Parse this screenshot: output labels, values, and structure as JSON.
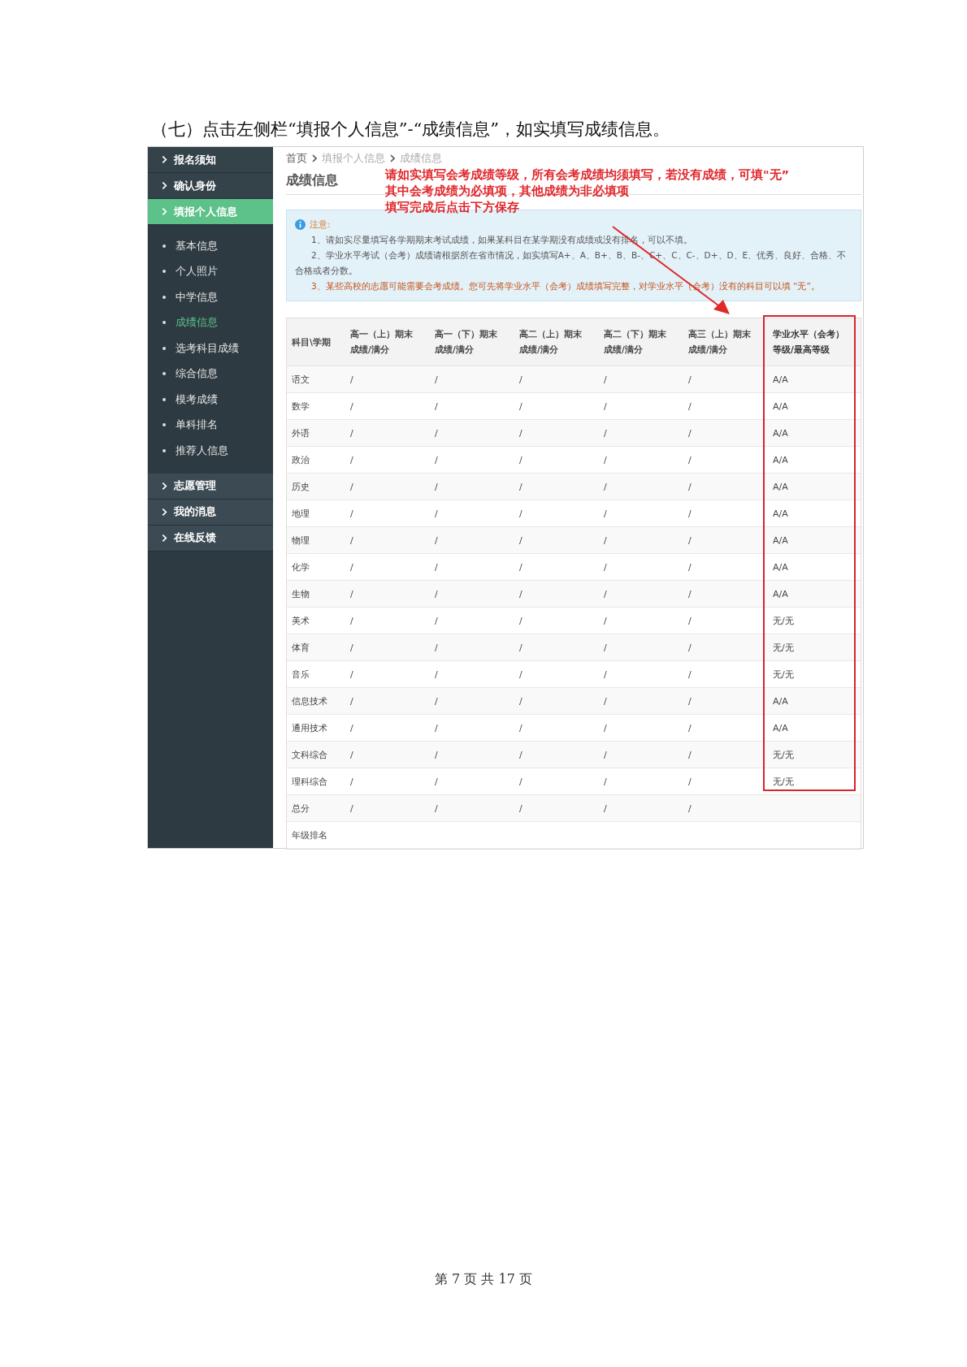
{
  "caption": "（七）点击左侧栏“填报个人信息”-“成绩信息”，如实填写成绩信息。",
  "sidebar": {
    "items": [
      {
        "label": "报名须知",
        "selected": false
      },
      {
        "label": "确认身份",
        "selected": false
      },
      {
        "label": "填报个人信息",
        "selected": true,
        "expanded": true,
        "children": [
          {
            "label": "基本信息",
            "selected": false
          },
          {
            "label": "个人照片",
            "selected": false
          },
          {
            "label": "中学信息",
            "selected": false
          },
          {
            "label": "成绩信息",
            "selected": true
          },
          {
            "label": "选考科目成绩",
            "selected": false
          },
          {
            "label": "综合信息",
            "selected": false
          },
          {
            "label": "模考成绩",
            "selected": false
          },
          {
            "label": "单科排名",
            "selected": false
          },
          {
            "label": "推荐人信息",
            "selected": false
          }
        ]
      },
      {
        "label": "志愿管理",
        "selected": false
      },
      {
        "label": "我的消息",
        "selected": false
      },
      {
        "label": "在线反馈",
        "selected": false
      }
    ]
  },
  "breadcrumb": [
    "首页",
    "填报个人信息",
    "成绩信息"
  ],
  "page_title": "成绩信息",
  "annotation": {
    "lines": [
      "请如实填写会考成绩等级，所有会考成绩均须填写，若没有成绩，可填\"无”",
      "其中会考成绩为必填项，其他成绩为非必填项",
      "填写完成后点击下方保存"
    ]
  },
  "notice": {
    "title": "注意:",
    "items": [
      {
        "kind": "normal",
        "text": "1、请如实尽量填写各学期期末考试成绩，如果某科目在某学期没有成绩或没有排名，可以不填。"
      },
      {
        "kind": "normal",
        "text": "2、学业水平考试（会考）成绩请根据所在省市情况，如实填写A+、A、B+、B、B-、C+、C、C-、D+、D、E、优秀、良好、合格、不合格或者分数。"
      },
      {
        "kind": "warning",
        "text": "3、某些高校的志愿可能需要会考成绩。您可先将学业水平（会考）成绩填写完整，对学业水平（会考）没有的科目可以填 “无”。"
      }
    ]
  },
  "table": {
    "columns": [
      {
        "title": "科目\\学期",
        "highlighted": false
      },
      {
        "title": "高一（上）期末",
        "subtitle": "成绩/满分",
        "highlighted": false
      },
      {
        "title": "高一（下）期末",
        "subtitle": "成绩/满分",
        "highlighted": false
      },
      {
        "title": "高二（上）期末",
        "subtitle": "成绩/满分",
        "highlighted": false
      },
      {
        "title": "高二（下）期末",
        "subtitle": "成绩/满分",
        "highlighted": false
      },
      {
        "title": "高三（上）期末",
        "subtitle": "成绩/满分",
        "highlighted": false
      },
      {
        "title": "学业水平（会考）",
        "subtitle": "等级/最高等级",
        "highlighted": true
      }
    ],
    "rows": [
      {
        "cells": [
          "语文",
          "/",
          "/",
          "/",
          "/",
          "/",
          "A/A"
        ]
      },
      {
        "cells": [
          "数学",
          "/",
          "/",
          "/",
          "/",
          "/",
          "A/A"
        ]
      },
      {
        "cells": [
          "外语",
          "/",
          "/",
          "/",
          "/",
          "/",
          "A/A"
        ]
      },
      {
        "cells": [
          "政治",
          "/",
          "/",
          "/",
          "/",
          "/",
          "A/A"
        ]
      },
      {
        "cells": [
          "历史",
          "/",
          "/",
          "/",
          "/",
          "/",
          "A/A"
        ]
      },
      {
        "cells": [
          "地理",
          "/",
          "/",
          "/",
          "/",
          "/",
          "A/A"
        ]
      },
      {
        "cells": [
          "物理",
          "/",
          "/",
          "/",
          "/",
          "/",
          "A/A"
        ]
      },
      {
        "cells": [
          "化学",
          "/",
          "/",
          "/",
          "/",
          "/",
          "A/A"
        ]
      },
      {
        "cells": [
          "生物",
          "/",
          "/",
          "/",
          "/",
          "/",
          "A/A"
        ]
      },
      {
        "cells": [
          "美术",
          "/",
          "/",
          "/",
          "/",
          "/",
          "无/无"
        ]
      },
      {
        "cells": [
          "体育",
          "/",
          "/",
          "/",
          "/",
          "/",
          "无/无"
        ]
      },
      {
        "cells": [
          "音乐",
          "/",
          "/",
          "/",
          "/",
          "/",
          "无/无"
        ]
      },
      {
        "cells": [
          "信息技术",
          "/",
          "/",
          "/",
          "/",
          "/",
          "A/A"
        ]
      },
      {
        "cells": [
          "通用技术",
          "/",
          "/",
          "/",
          "/",
          "/",
          "A/A"
        ]
      },
      {
        "cells": [
          "文科综合",
          "/",
          "/",
          "/",
          "/",
          "/",
          "无/无"
        ]
      },
      {
        "cells": [
          "理科综合",
          "/",
          "/",
          "/",
          "/",
          "/",
          "无/无"
        ]
      },
      {
        "cells": [
          "总分",
          "/",
          "/",
          "/",
          "/",
          "/"
        ]
      },
      {
        "cells": [
          "年级排名"
        ]
      }
    ]
  },
  "footer": "第 7 页 共 17 页"
}
